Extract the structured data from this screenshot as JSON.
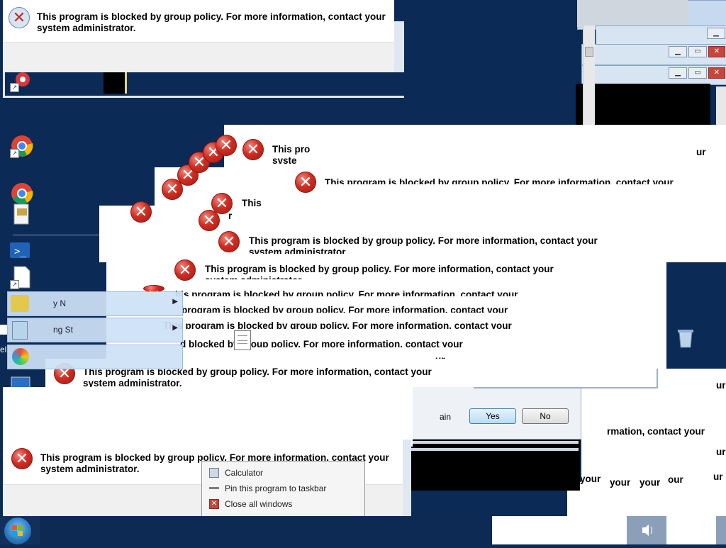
{
  "dialog": {
    "message_line1": "This program is blocked by group policy. For more information, contact your",
    "message_line2": "system administrator."
  },
  "fragments": {
    "f1": "This pro",
    "f2": "syste",
    "f3": "This program is blocked by group policy. For more information, contact your",
    "f4": "This",
    "f5": "r",
    "f6": "This program is blocked by group policy. For more information, contact your",
    "f7": "his program is blocked by group policy. For more information, contact your",
    "f8": "program is blocked by group policy. For more information, contact your",
    "f9": "This program is blocked by group policy. For more information, contact your",
    "f10": "d blocked by group policy. For more information, contact your",
    "f11": "ur",
    "f12": "ur",
    "f13": "rmation, contact your",
    "f14": "your",
    "f15": "your",
    "f16": "your",
    "f17": "our",
    "f18": "ur",
    "f19": "ur",
    "f20": "ur",
    "f21": "ain"
  },
  "confirm_dialog": {
    "yes_label": "Yes",
    "no_label": "No"
  },
  "start_menu": {
    "item1": "y N",
    "item2": "ng St"
  },
  "jump_list": {
    "items": [
      {
        "label": "Calculator",
        "icon": "calculator-icon"
      },
      {
        "label": "Pin this program to taskbar",
        "icon": "pin-icon"
      },
      {
        "label": "Close all windows",
        "icon": "close-windows-icon"
      }
    ]
  },
  "desktop": {
    "left_edge_text": "ell"
  },
  "colors": {
    "desktop": "#0b2a55",
    "taskbar": "#13305c",
    "error_red": "#d12d22"
  }
}
